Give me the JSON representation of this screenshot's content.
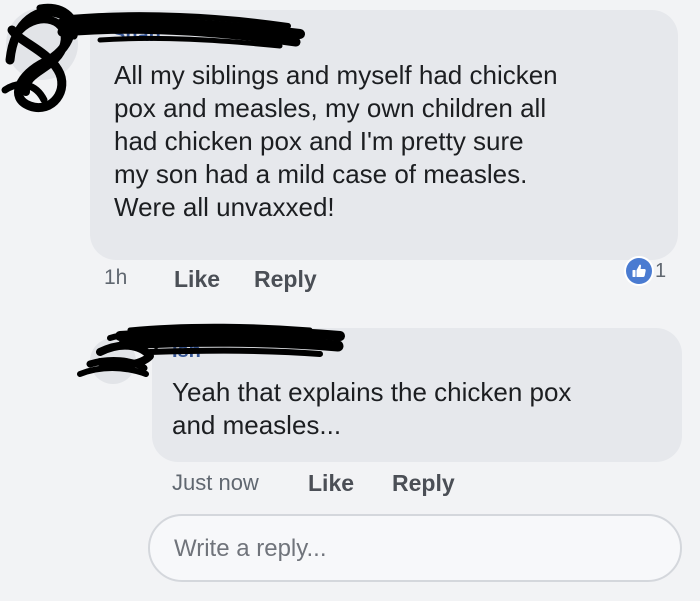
{
  "comments": [
    {
      "author": "Shan",
      "text": "All my siblings and myself had chicken\npox and measles,  my own children all\nhad chicken pox and I'm pretty sure\nmy son had a mild case of measles.\nWere all unvaxxed!",
      "time": "1h",
      "like_label": "Like",
      "reply_label": "Reply",
      "reaction_count": "1",
      "reaction_icon": "thumbs-up-icon",
      "reaction_color": "#4a7bd1"
    },
    {
      "author": "Ish",
      "text": "Yeah that explains the chicken pox\nand measles...",
      "time": "Just now",
      "like_label": "Like",
      "reply_label": "Reply"
    }
  ],
  "reply_box": {
    "placeholder": "Write a reply..."
  },
  "colors": {
    "background": "#f2f3f5",
    "bubble": "#e6e8ec",
    "redaction": "#000000"
  }
}
